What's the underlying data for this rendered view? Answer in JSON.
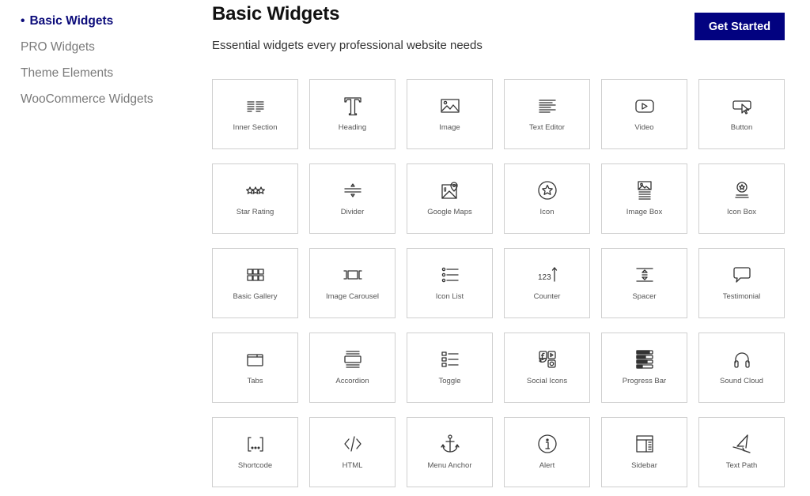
{
  "sidebar": {
    "items": [
      {
        "label": "Basic Widgets",
        "active": true,
        "bullet": "•"
      },
      {
        "label": "PRO Widgets",
        "active": false
      },
      {
        "label": "Theme Elements",
        "active": false
      },
      {
        "label": "WooCommerce Widgets",
        "active": false
      }
    ]
  },
  "header": {
    "title": "Basic Widgets",
    "subtitle": "Essential widgets every professional website needs",
    "cta_label": "Get Started"
  },
  "colors": {
    "accent": "#020280",
    "active_nav": "#0b0b7a",
    "card_border": "#cfcfcf"
  },
  "widgets": [
    {
      "label": "Inner Section",
      "icon": "inner-section"
    },
    {
      "label": "Heading",
      "icon": "heading"
    },
    {
      "label": "Image",
      "icon": "image"
    },
    {
      "label": "Text Editor",
      "icon": "text-editor"
    },
    {
      "label": "Video",
      "icon": "video"
    },
    {
      "label": "Button",
      "icon": "button"
    },
    {
      "label": "Star Rating",
      "icon": "star-rating"
    },
    {
      "label": "Divider",
      "icon": "divider"
    },
    {
      "label": "Google Maps",
      "icon": "google-maps"
    },
    {
      "label": "Icon",
      "icon": "icon"
    },
    {
      "label": "Image Box",
      "icon": "image-box"
    },
    {
      "label": "Icon Box",
      "icon": "icon-box"
    },
    {
      "label": "Basic Gallery",
      "icon": "basic-gallery"
    },
    {
      "label": "Image Carousel",
      "icon": "image-carousel"
    },
    {
      "label": "Icon List",
      "icon": "icon-list"
    },
    {
      "label": "Counter",
      "icon": "counter"
    },
    {
      "label": "Spacer",
      "icon": "spacer"
    },
    {
      "label": "Testimonial",
      "icon": "testimonial"
    },
    {
      "label": "Tabs",
      "icon": "tabs"
    },
    {
      "label": "Accordion",
      "icon": "accordion"
    },
    {
      "label": "Toggle",
      "icon": "toggle"
    },
    {
      "label": "Social Icons",
      "icon": "social-icons"
    },
    {
      "label": "Progress Bar",
      "icon": "progress-bar"
    },
    {
      "label": "Sound Cloud",
      "icon": "sound-cloud"
    },
    {
      "label": "Shortcode",
      "icon": "shortcode"
    },
    {
      "label": "HTML",
      "icon": "html"
    },
    {
      "label": "Menu Anchor",
      "icon": "menu-anchor"
    },
    {
      "label": "Alert",
      "icon": "alert"
    },
    {
      "label": "Sidebar",
      "icon": "sidebar"
    },
    {
      "label": "Text Path",
      "icon": "text-path"
    }
  ]
}
